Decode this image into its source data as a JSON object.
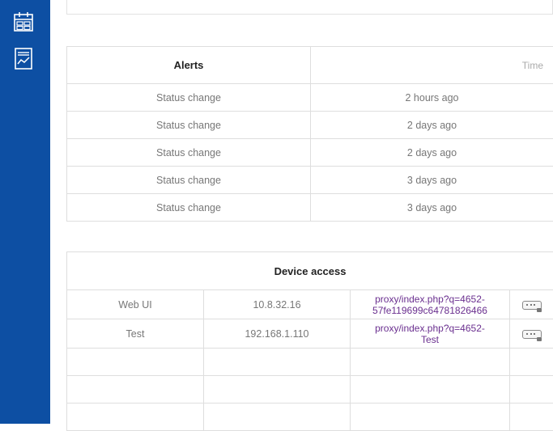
{
  "sidebar": {
    "items": [
      {
        "icon": "calendar-icon"
      },
      {
        "icon": "chart-report-icon"
      }
    ]
  },
  "alerts": {
    "header_label": "Alerts",
    "header_time": "Time",
    "rows": [
      {
        "label": "Status change",
        "time": "2 hours ago"
      },
      {
        "label": "Status change",
        "time": "2 days ago"
      },
      {
        "label": "Status change",
        "time": "2 days ago"
      },
      {
        "label": "Status change",
        "time": "3 days ago"
      },
      {
        "label": "Status change",
        "time": "3 days ago"
      }
    ]
  },
  "devices": {
    "title": "Device access",
    "rows": [
      {
        "name": "Web UI",
        "ip": "10.8.32.16",
        "link_line1": "proxy/index.php?q=4652-",
        "link_line2": "57fe119699c64781826466",
        "icon": "keyboard-icon"
      },
      {
        "name": "Test",
        "ip": "192.168.1.110",
        "link_line1": "proxy/index.php?q=4652-",
        "link_line2": "Test",
        "icon": "keyboard-icon"
      }
    ]
  },
  "colors": {
    "sidebar": "#0d4fa3",
    "link": "#6a2f8f"
  }
}
